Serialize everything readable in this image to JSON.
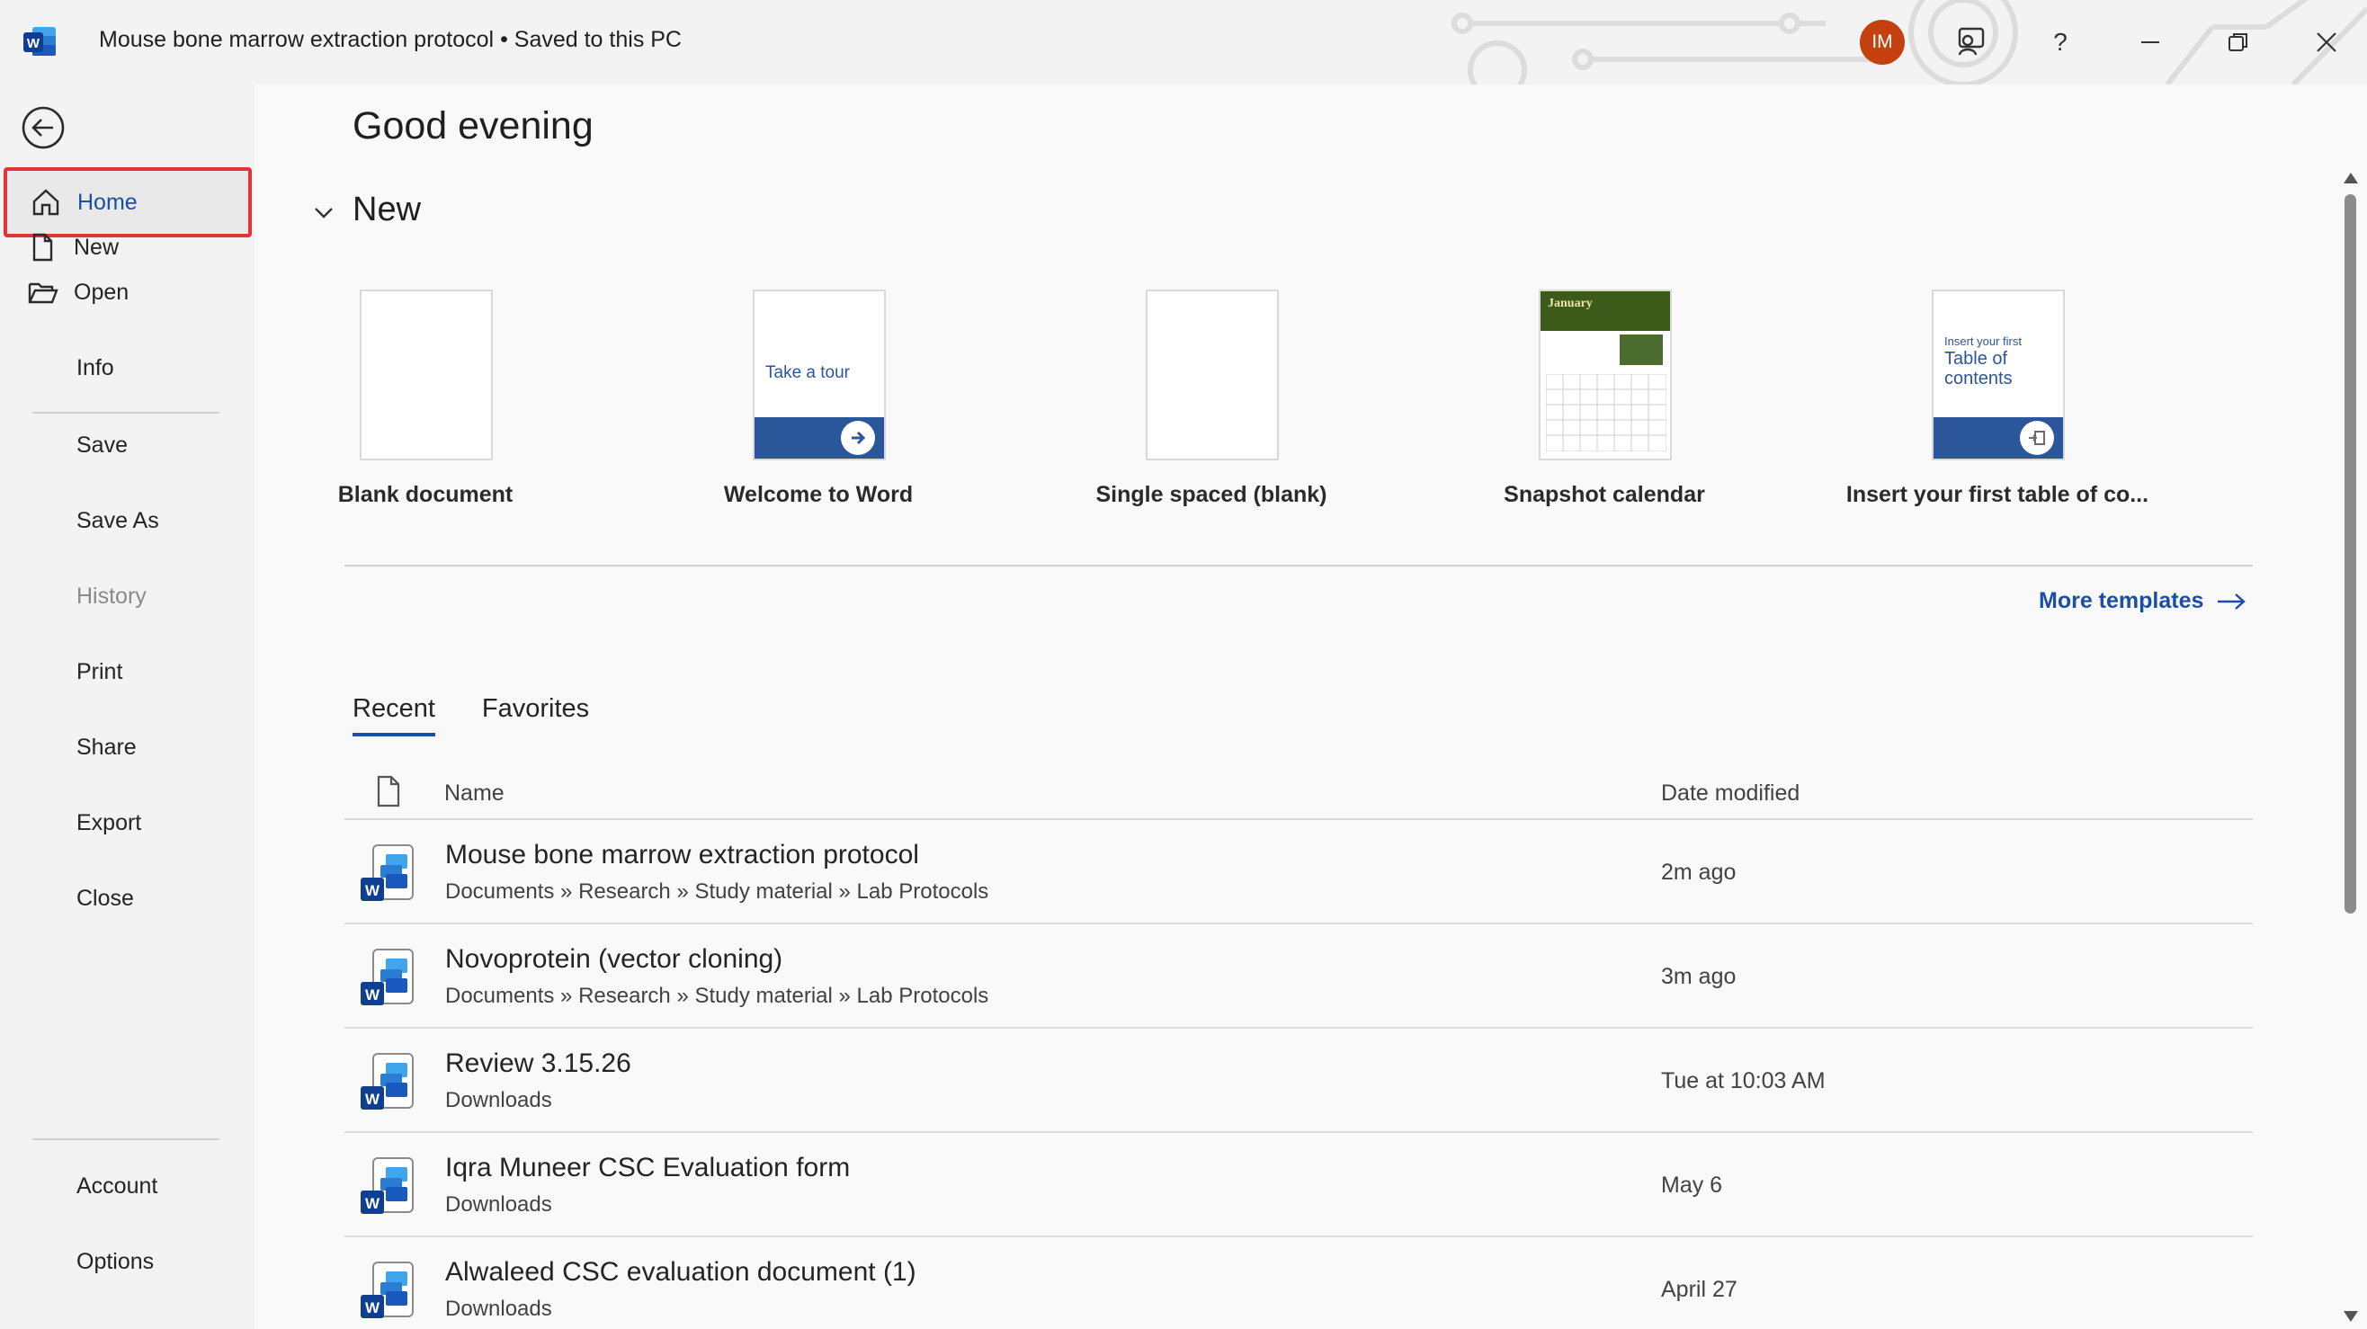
{
  "titlebar": {
    "app_icon": "word-logo-icon",
    "doc_name": "Mouse bone marrow extraction protocol",
    "separator": "•",
    "save_status": "Saved to this PC",
    "avatar_initials": "IM",
    "icons": [
      "feedback-icon",
      "help-icon",
      "minimize-icon",
      "restore-icon",
      "close-icon"
    ],
    "help_glyph": "?"
  },
  "sidebar": {
    "items": [
      {
        "label": "Home",
        "icon": "home-icon"
      },
      {
        "label": "New",
        "icon": "new-document-icon"
      },
      {
        "label": "Open",
        "icon": "folder-open-icon"
      },
      {
        "label": "Info"
      },
      {
        "label": "Save"
      },
      {
        "label": "Save As"
      },
      {
        "label": "History"
      },
      {
        "label": "Print"
      },
      {
        "label": "Share"
      },
      {
        "label": "Export"
      },
      {
        "label": "Close"
      },
      {
        "label": "Account"
      },
      {
        "label": "Options"
      }
    ]
  },
  "main": {
    "greeting": "Good evening",
    "new_section_title": "New",
    "templates": [
      {
        "name": "Blank document"
      },
      {
        "name": "Welcome to Word",
        "thumb_text": "Take a tour"
      },
      {
        "name": "Single spaced (blank)"
      },
      {
        "name": "Snapshot calendar",
        "thumb_text": "January"
      },
      {
        "name": "Insert your first table of co...",
        "thumb_small": "Insert your first",
        "thumb_big": "Table of contents"
      }
    ],
    "more_templates": "More templates",
    "tabs": [
      "Recent",
      "Favorites"
    ],
    "table": {
      "col_name": "Name",
      "col_date": "Date modified",
      "rows": [
        {
          "name": "Mouse bone marrow extraction protocol",
          "path": "Documents » Research » Study material » Lab Protocols",
          "date": "2m ago"
        },
        {
          "name": "Novoprotein (vector cloning)",
          "path": "Documents » Research » Study material » Lab Protocols",
          "date": "3m ago"
        },
        {
          "name": "Review 3.15.26",
          "path": "Downloads",
          "date": "Tue at 10:03 AM"
        },
        {
          "name": "Iqra Muneer CSC Evaluation form",
          "path": "Downloads",
          "date": "May 6"
        },
        {
          "name": "Alwaleed CSC evaluation document (1)",
          "path": "Downloads",
          "date": "April 27"
        }
      ]
    }
  },
  "colors": {
    "accent": "#1b4fa6",
    "word_blue": "#2b579a",
    "highlight_border": "#e0343a",
    "avatar_bg": "#c4410f"
  }
}
